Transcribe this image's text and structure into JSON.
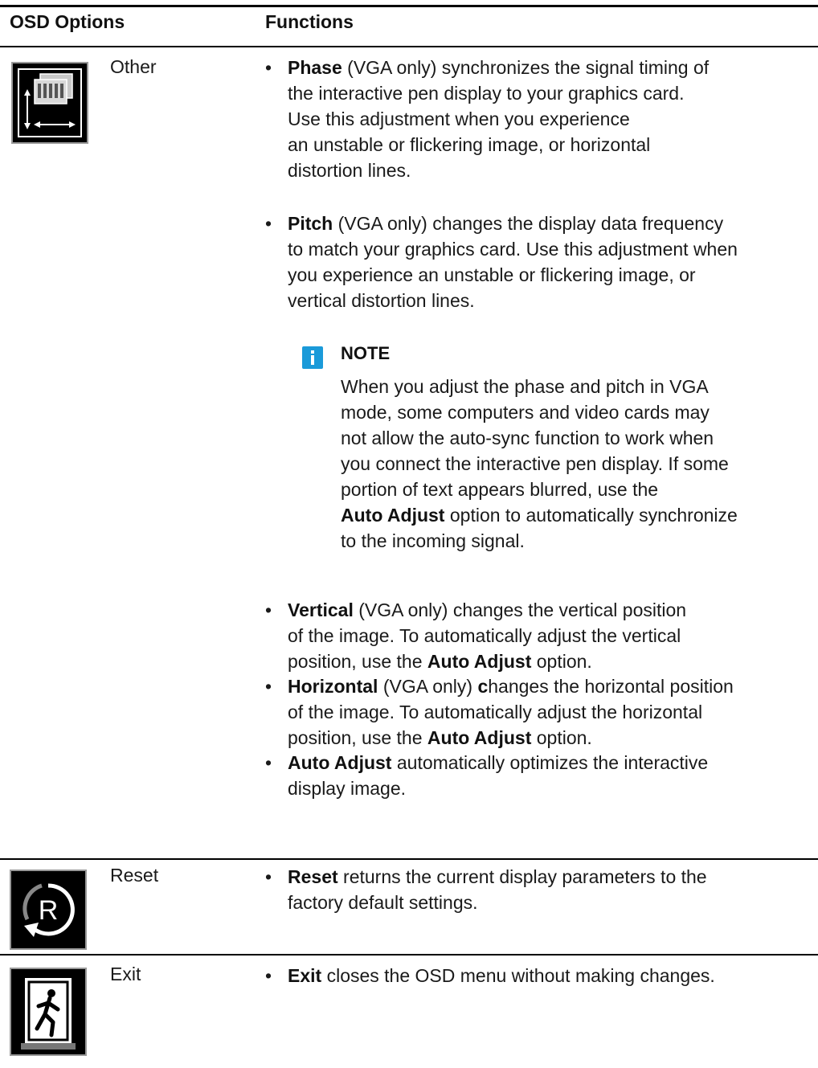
{
  "header": {
    "col1": "OSD Options",
    "col2": "Functions"
  },
  "rows": [
    {
      "name": "Other",
      "icon": "osd-other-icon",
      "bullets": [
        {
          "lines": [
            [
              {
                "b": "Phase"
              },
              {
                "t": " (VGA only) synchronizes the signal timing of"
              }
            ],
            [
              {
                "t": "the interactive pen display to your graphics card."
              }
            ],
            [
              {
                "t": "Use this adjustment when you experience"
              }
            ],
            [
              {
                "t": "an unstable or flickering image, or horizontal"
              }
            ],
            [
              {
                "t": "distortion lines."
              }
            ]
          ]
        },
        {
          "lines": [
            [
              {
                "b": "Pitch"
              },
              {
                "t": " (VGA only) changes the display data frequency"
              }
            ],
            [
              {
                "t": "to match your graphics card. Use this adjustment when"
              }
            ],
            [
              {
                "t": "you experience an unstable or flickering image, or"
              }
            ],
            [
              {
                "t": "vertical distortion lines."
              }
            ]
          ]
        },
        {
          "lines": [
            [
              {
                "b": "Vertical"
              },
              {
                "t": " (VGA only) changes the vertical position"
              }
            ],
            [
              {
                "t": "of the image. To automatically adjust the vertical"
              }
            ],
            [
              {
                "t": "position, use the "
              },
              {
                "b": "Auto Adjust"
              },
              {
                "t": " option."
              }
            ]
          ]
        },
        {
          "lines": [
            [
              {
                "b": "Horizontal"
              },
              {
                "t": " (VGA only) "
              },
              {
                "b": "c"
              },
              {
                "t": "hanges the horizontal position"
              }
            ],
            [
              {
                "t": "of the image. To automatically adjust the horizontal"
              }
            ],
            [
              {
                "t": "position, use the "
              },
              {
                "b": "Auto Adjust"
              },
              {
                "t": " option."
              }
            ]
          ]
        },
        {
          "lines": [
            [
              {
                "b": "Auto Adjust"
              },
              {
                "t": " automatically optimizes the interactive"
              }
            ],
            [
              {
                "t": "display image."
              }
            ]
          ]
        }
      ],
      "note": {
        "label": "NOTE",
        "lines": [
          [
            {
              "t": "When you adjust the phase and pitch in VGA"
            }
          ],
          [
            {
              "t": "mode, some computers and video cards may"
            }
          ],
          [
            {
              "t": "not allow the auto-sync function to work when"
            }
          ],
          [
            {
              "t": "you connect the interactive pen display. If some"
            }
          ],
          [
            {
              "t": "portion of text appears blurred, use the"
            }
          ],
          [
            {
              "b": "Auto Adjust"
            },
            {
              "t": " option to automatically synchronize"
            }
          ],
          [
            {
              "t": "to the incoming signal."
            }
          ]
        ]
      }
    },
    {
      "name": "Reset",
      "icon": "osd-reset-icon",
      "bullets": [
        {
          "lines": [
            [
              {
                "b": "Reset"
              },
              {
                "t": " returns the current display parameters to the"
              }
            ],
            [
              {
                "t": "factory default settings."
              }
            ]
          ]
        }
      ]
    },
    {
      "name": "Exit",
      "icon": "osd-exit-icon",
      "bullets": [
        {
          "lines": [
            [
              {
                "b": "Exit"
              },
              {
                "t": " closes the OSD menu without making changes."
              }
            ]
          ]
        }
      ]
    }
  ],
  "bullet_char": "•",
  "note_icon_glyph": "i"
}
